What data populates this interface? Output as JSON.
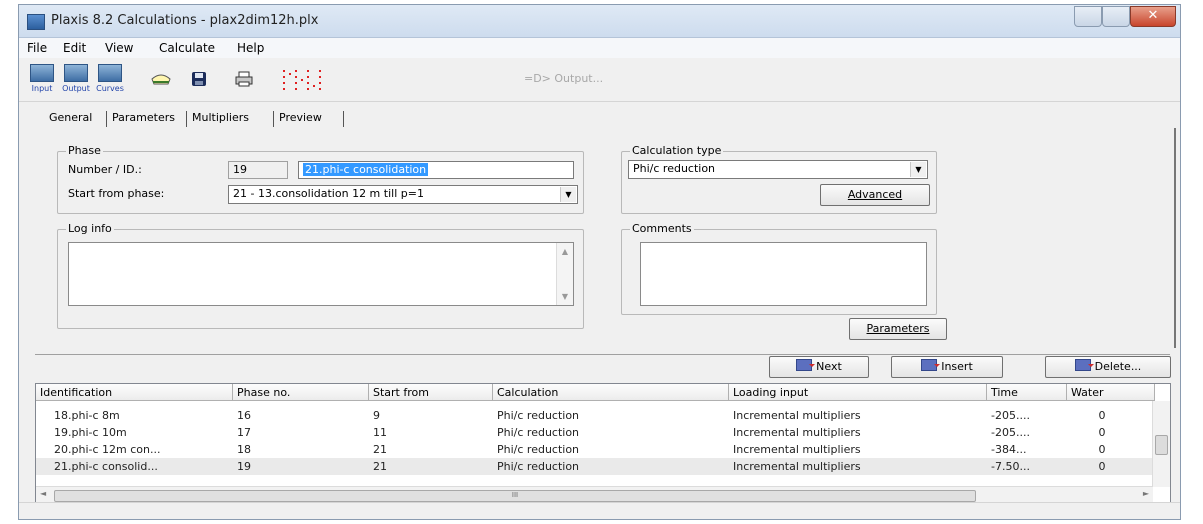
{
  "window": {
    "title": "Plaxis 8.2 Calculations - plax2dim12h.plx",
    "close_glyph": "✕"
  },
  "menu": [
    "File",
    "Edit",
    "View",
    "Calculate",
    "Help"
  ],
  "toolbar": {
    "input_label": "Input",
    "output_label": "Output",
    "curves_label": "Curves",
    "output_button": "=D> Output..."
  },
  "tabs": [
    "General",
    "Parameters",
    "Multipliers",
    "Preview"
  ],
  "phase": {
    "group_label": "Phase",
    "number_label": "Number / ID.:",
    "number_value": "19",
    "id_value": "21.phi-c consolidation",
    "start_label": "Start from phase:",
    "start_value": "21 - 13.consolidation  12 m till p=1"
  },
  "calculation_type": {
    "group_label": "Calculation type",
    "value": "Phi/c reduction",
    "advanced_button": "Advanced"
  },
  "log_info": {
    "label": "Log info"
  },
  "comments": {
    "label": "Comments"
  },
  "parameters_button": "Parameters",
  "actions": {
    "next": "Next",
    "insert": "Insert",
    "delete": "Delete..."
  },
  "table": {
    "columns": [
      "Identification",
      "Phase no.",
      "Start from",
      "Calculation",
      "Loading input",
      "Time",
      "Water"
    ],
    "rows": [
      [
        "18.phi-c 8m",
        "16",
        "9",
        "Phi/c reduction",
        "Incremental multipliers",
        "-205....",
        "0"
      ],
      [
        "19.phi-c 10m",
        "17",
        "11",
        "Phi/c reduction",
        "Incremental multipliers",
        "-205....",
        "0"
      ],
      [
        "20.phi-c 12m con...",
        "18",
        "21",
        "Phi/c reduction",
        "Incremental multipliers",
        "-384...",
        "0"
      ],
      [
        "21.phi-c consolid...",
        "19",
        "21",
        "Phi/c reduction",
        "Incremental multipliers",
        "-7.50...",
        "0"
      ]
    ],
    "hscroll_grip": "III"
  },
  "colors": {
    "selection": "#3399ff",
    "titlebar": "#dfe9f5",
    "close": "#c8452c"
  }
}
